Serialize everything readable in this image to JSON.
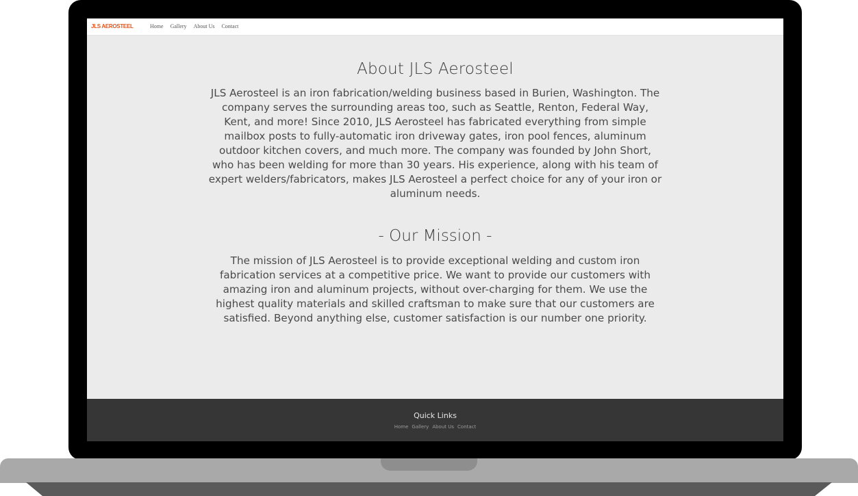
{
  "navbar": {
    "brand": "JLS AEROSTEEL",
    "links": [
      "Home",
      "Gallery",
      "About Us",
      "Contact"
    ]
  },
  "about": {
    "title": "About JLS Aerosteel",
    "body": "JLS Aerosteel is an iron fabrication/welding business based in Burien, Washington. The company serves the surrounding areas too, such as Seattle, Renton, Federal Way, Kent, and more! Since 2010, JLS Aerosteel has fabricated everything from simple mailbox posts to fully-automatic iron driveway gates, iron pool fences, aluminum outdoor kitchen covers, and much more. The company was founded by John Short, who has been welding for more than 30 years. His experience, along with his team of expert welders/fabricators, makes JLS Aerosteel a perfect choice for any of your iron or aluminum needs."
  },
  "mission": {
    "title": "- Our Mission -",
    "body": "The mission of JLS Aerosteel is to provide exceptional welding and custom iron fabrication services at a competitive price. We want to provide our customers with amazing iron and aluminum projects, without over-charging for them. We use the highest quality materials and skilled craftsman to make sure that our customers are satisfied. Beyond anything else, customer satisfaction is our number one priority."
  },
  "footer": {
    "title": "Quick Links",
    "links": [
      "Home",
      "Gallery",
      "About Us",
      "Contact"
    ]
  },
  "colors": {
    "brand_accent": "#e5531a",
    "content_bg": "#ebebeb",
    "footer_bg": "#363636",
    "bezel": "#000000"
  }
}
